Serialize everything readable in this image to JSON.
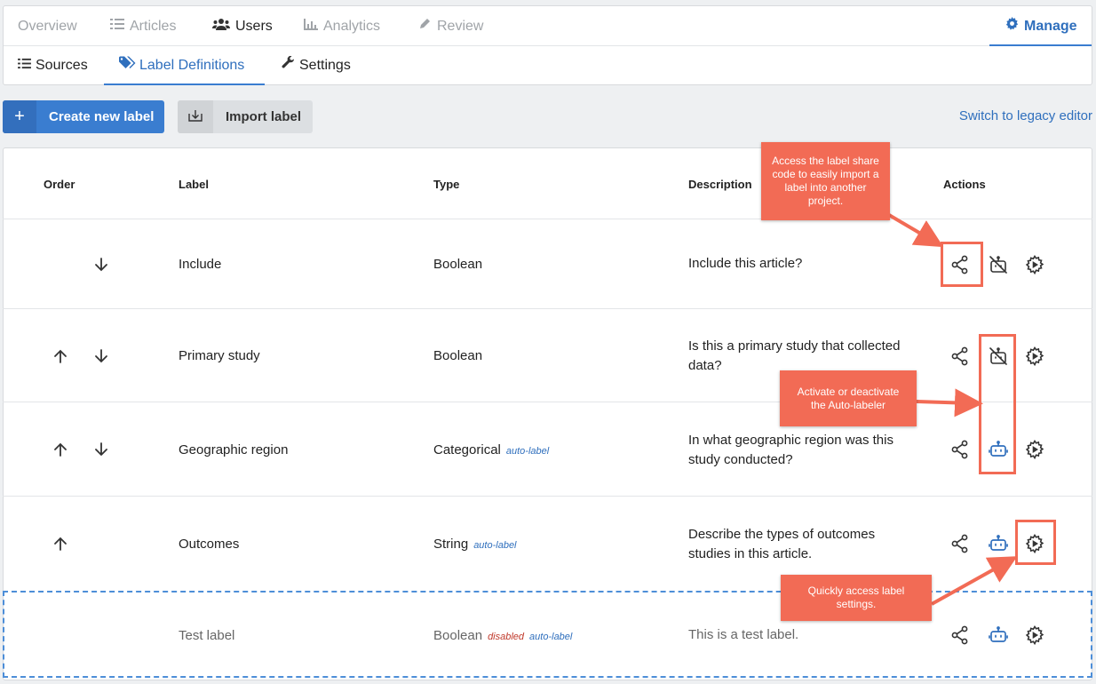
{
  "main_nav": {
    "overview": "Overview",
    "articles": "Articles",
    "users": "Users",
    "analytics": "Analytics",
    "review": "Review",
    "manage": "Manage"
  },
  "sub_nav": {
    "sources": "Sources",
    "label_definitions": "Label Definitions",
    "settings": "Settings"
  },
  "toolbar": {
    "create_label": "Create new label",
    "import_label": "Import label",
    "legacy_link": "Switch to legacy editor"
  },
  "table": {
    "headers": {
      "order": "Order",
      "label": "Label",
      "type": "Type",
      "description": "Description",
      "actions": "Actions"
    },
    "rows": [
      {
        "label": "Include",
        "type": "Boolean",
        "description": "Include this article?"
      },
      {
        "label": "Primary study",
        "type": "Boolean",
        "description": "Is this a primary study that collected data?"
      },
      {
        "label": "Geographic region",
        "type": "Categorical",
        "auto_tag": "auto-label",
        "description": "In what geographic region was this study conducted?"
      },
      {
        "label": "Outcomes",
        "type": "String",
        "auto_tag": "auto-label",
        "description": "Describe the types of outcomes studies in this article."
      },
      {
        "label": "Test label",
        "type": "Boolean",
        "disabled_tag": "disabled",
        "auto_tag": "auto-label",
        "description": "This is a test label."
      }
    ]
  },
  "annotations": {
    "share": "Access the label share code to easily import a label into another project.",
    "autolabel": "Activate or deactivate the Auto-labeler",
    "settings": "Quickly access label settings."
  },
  "colors": {
    "primary": "#3a7dd0",
    "callout": "#f26b55",
    "link": "#2f6fbd"
  },
  "icons": [
    "list-icon",
    "users-icon",
    "chart-icon",
    "pencil-icon",
    "gear-icon",
    "tags-icon",
    "wrench-icon",
    "plus-icon",
    "import-icon",
    "arrow-up-icon",
    "arrow-down-icon",
    "share-icon",
    "robot-off-icon",
    "robot-icon",
    "settings-icon"
  ]
}
